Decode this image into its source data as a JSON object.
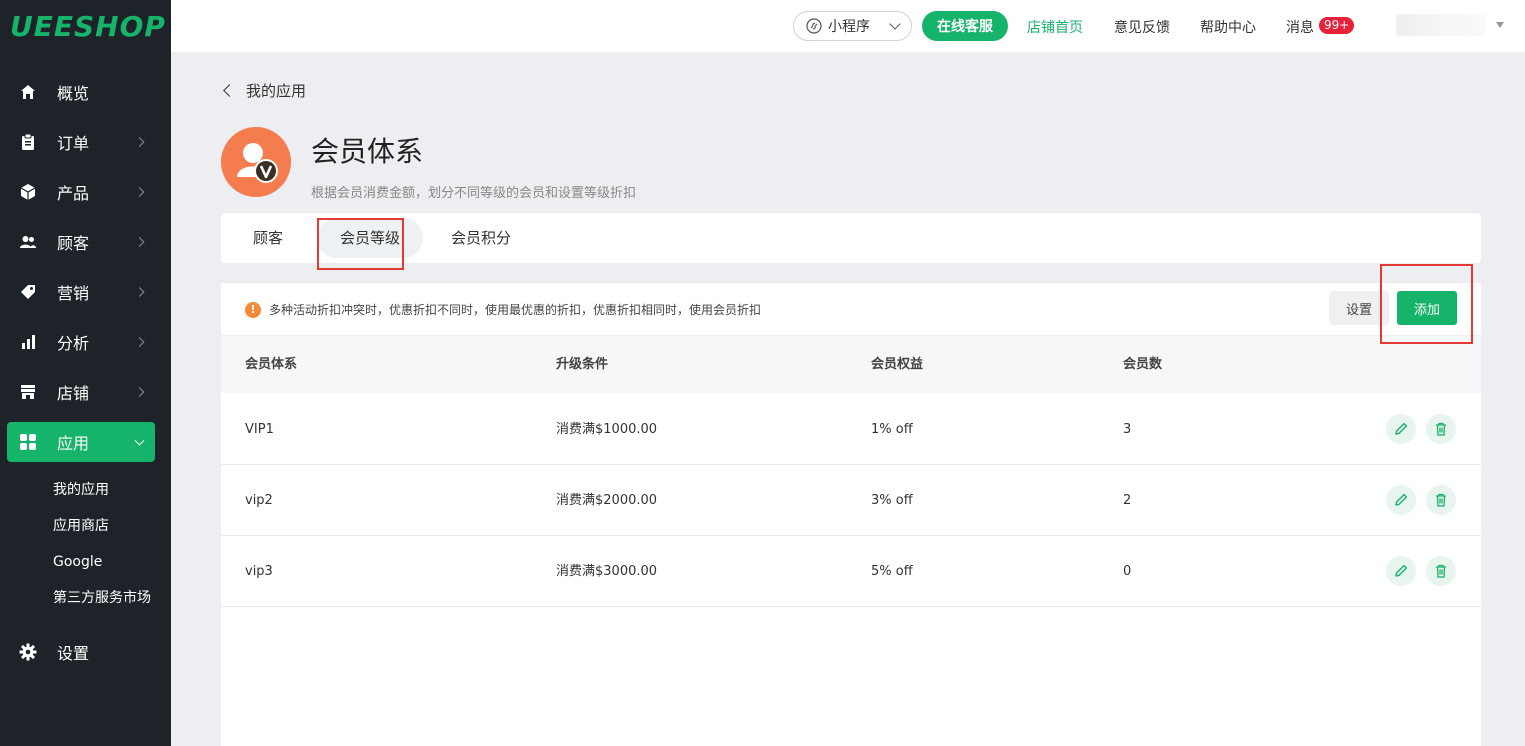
{
  "brand": {
    "logo": "UEESHOP",
    "color": "#16b36a"
  },
  "sidebar": {
    "items": [
      {
        "label": "概览",
        "icon": "home-icon"
      },
      {
        "label": "订单",
        "icon": "clipboard-icon"
      },
      {
        "label": "产品",
        "icon": "box-icon"
      },
      {
        "label": "顾客",
        "icon": "users-icon"
      },
      {
        "label": "营销",
        "icon": "tag-icon"
      },
      {
        "label": "分析",
        "icon": "bar-chart-icon"
      },
      {
        "label": "店铺",
        "icon": "store-icon"
      },
      {
        "label": "应用",
        "icon": "apps-grid-icon"
      }
    ],
    "sub_items": [
      "我的应用",
      "应用商店",
      "Google",
      "第三方服务市场"
    ],
    "settings_label": "设置"
  },
  "topbar": {
    "mini_program": "小程序",
    "online_service": "在线客服",
    "store_home": "店铺首页",
    "feedback": "意见反馈",
    "help": "帮助中心",
    "messages": "消息",
    "message_badge": "99+"
  },
  "page": {
    "back_label": "我的应用",
    "title": "会员体系",
    "description": "根据会员消费金额，划分不同等级的会员和设置等级折扣"
  },
  "tabs": [
    "顾客",
    "会员等级",
    "会员积分"
  ],
  "notice": "多种活动折扣冲突时，优惠折扣不同时，使用最优惠的折扣，优惠折扣相同时，使用会员折扣",
  "toolbar": {
    "settings": "设置",
    "add": "添加"
  },
  "table": {
    "headers": [
      "会员体系",
      "升级条件",
      "会员权益",
      "会员数"
    ],
    "rows": [
      {
        "name": "VIP1",
        "condition": "消费满$1000.00",
        "benefit": "1% off",
        "count": "3"
      },
      {
        "name": "vip2",
        "condition": "消费满$2000.00",
        "benefit": "3% off",
        "count": "2"
      },
      {
        "name": "vip3",
        "condition": "消费满$3000.00",
        "benefit": "5% off",
        "count": "0"
      }
    ]
  }
}
